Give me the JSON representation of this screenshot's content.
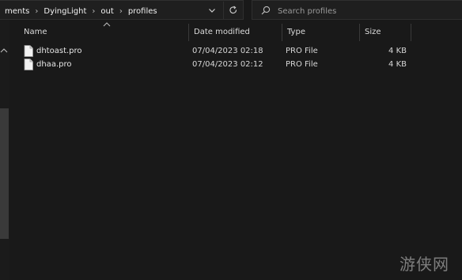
{
  "breadcrumb": {
    "items": [
      "ments",
      "DyingLight",
      "out",
      "profiles"
    ]
  },
  "search": {
    "placeholder": "Search profiles"
  },
  "columns": {
    "name": "Name",
    "date_modified": "Date modified",
    "type": "Type",
    "size": "Size"
  },
  "files": [
    {
      "name": "dhtoast.pro",
      "date_modified": "07/04/2023 02:18",
      "type": "PRO File",
      "size": "4 KB"
    },
    {
      "name": "dhaa.pro",
      "date_modified": "07/04/2023 02:12",
      "type": "PRO File",
      "size": "4 KB"
    }
  ],
  "icons": {
    "address_dropdown": "chevron-down-icon",
    "refresh": "refresh-icon",
    "search": "search-icon",
    "file": "file-icon",
    "sort": "sort-ascending-icon"
  },
  "watermark_text": "游侠网",
  "colors": {
    "background": "#191919",
    "text": "#e6e6e6",
    "border": "#2f2f2f"
  }
}
